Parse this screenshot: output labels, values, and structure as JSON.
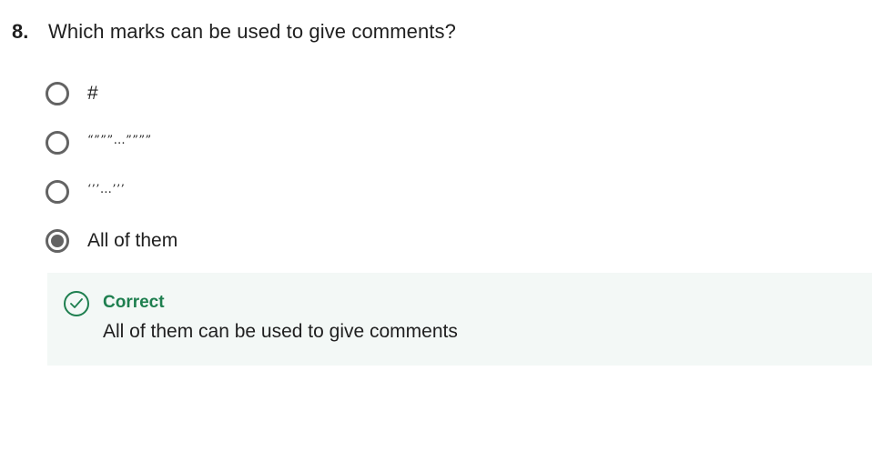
{
  "question": {
    "number": "8.",
    "text": "Which marks can be used to give comments?"
  },
  "options": [
    {
      "label": "#",
      "selected": false
    },
    {
      "label": "“”””…””””",
      "selected": false
    },
    {
      "label": "‘’’…’’’",
      "selected": false
    },
    {
      "label": "All of them",
      "selected": true
    }
  ],
  "feedback": {
    "icon": "check-circle-icon",
    "status": "Correct",
    "message": "All of them can be used to give comments",
    "color": "#1e7f4f",
    "background": "#f3f8f6"
  }
}
